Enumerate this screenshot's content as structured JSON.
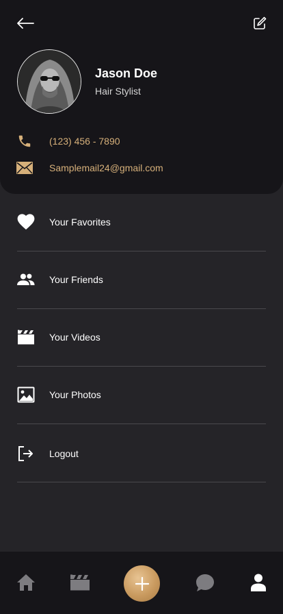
{
  "profile": {
    "name": "Jason Doe",
    "role": "Hair Stylist",
    "phone": "(123) 456 - 7890",
    "email": "Samplemail24@gmail.com"
  },
  "menu": {
    "items": [
      {
        "label": "Your Favorites",
        "icon": "heart-icon"
      },
      {
        "label": "Your Friends",
        "icon": "people-icon"
      },
      {
        "label": "Your Videos",
        "icon": "clapperboard-icon"
      },
      {
        "label": "Your Photos",
        "icon": "image-icon"
      },
      {
        "label": "Logout",
        "icon": "logout-icon"
      }
    ]
  },
  "bottom_nav": {
    "items": [
      "home-icon",
      "clapperboard-icon",
      "plus-icon",
      "chat-icon",
      "user-icon"
    ],
    "active": "user-icon"
  },
  "colors": {
    "background": "#252428",
    "header": "#161519",
    "accent_gold": "#d6b07a",
    "divider": "#4a494d"
  }
}
